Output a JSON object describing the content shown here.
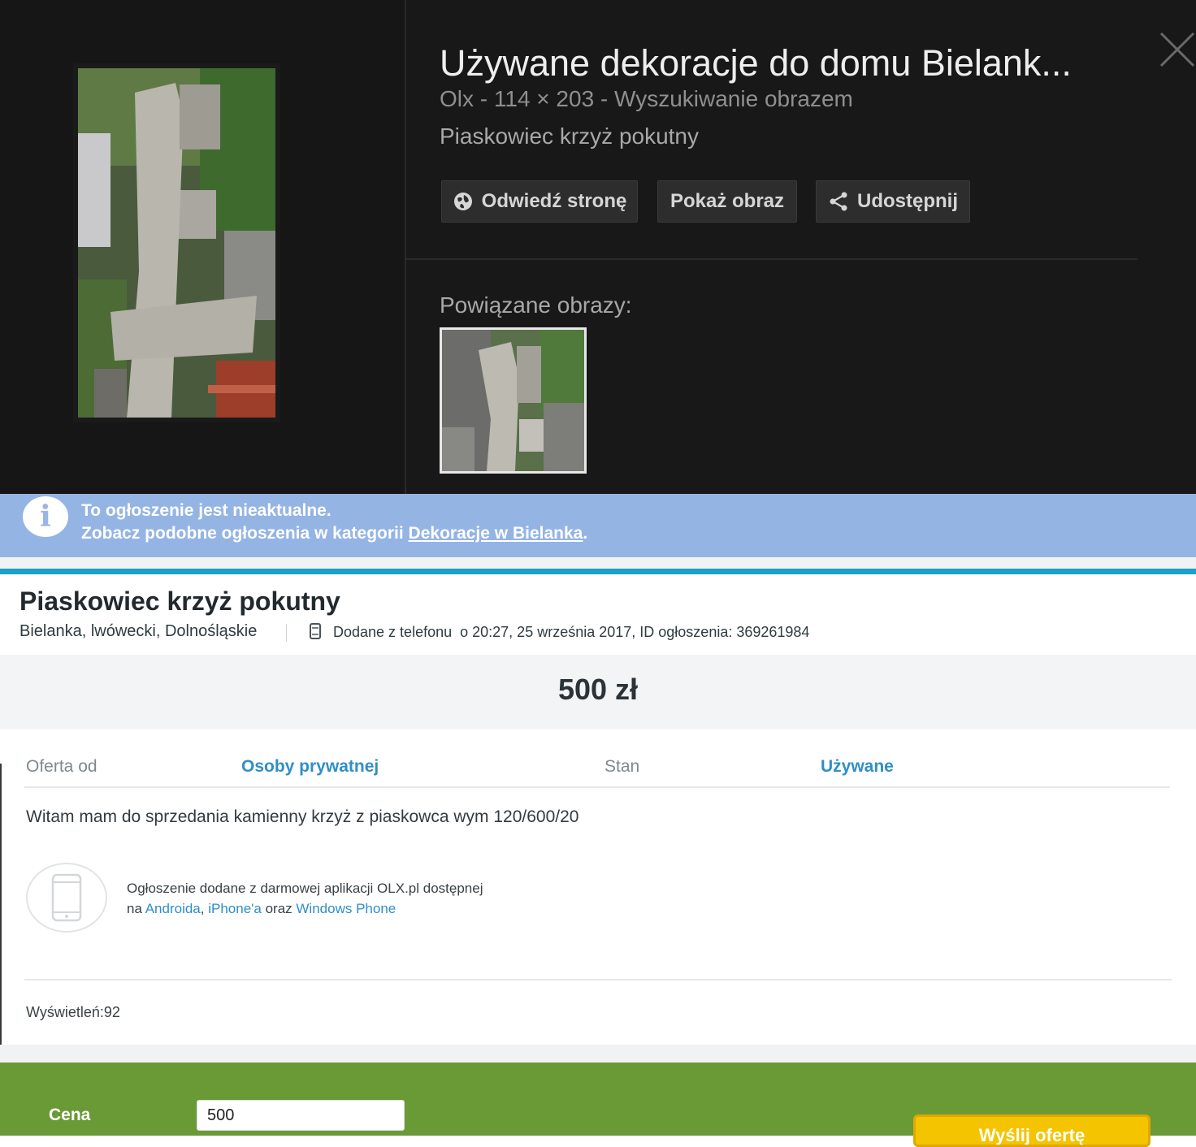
{
  "viewer": {
    "title": "Używane dekoracje do domu Bielank...",
    "meta": "Olx - 114 × 203 - Wyszukiwanie obrazem",
    "description": "Piaskowiec krzyż pokutny",
    "buttons": {
      "visit": "Odwiedź stronę",
      "show": "Pokaż obraz",
      "share": "Udostępnij"
    },
    "related_label": "Powiązane obrazy:"
  },
  "alert": {
    "line1": "To ogłoszenie jest nieaktualne.",
    "line2_prefix": "Zobacz podobne ogłoszenia w kategorii ",
    "line2_link": "Dekoracje w Bielanka",
    "line2_suffix": "."
  },
  "ad": {
    "title": "Piaskowiec krzyż pokutny",
    "location": "Bielanka, lwówecki, Dolnośląskie",
    "added_from": "Dodane z telefonu",
    "added_meta": "o 20:27, 25 września 2017, ID ogłoszenia: 369261984",
    "price": "500 zł",
    "details": [
      {
        "label": "Oferta od",
        "value": "Osoby prywatnej"
      },
      {
        "label": "Stan",
        "value": "Używane"
      }
    ],
    "description": "Witam mam do sprzedania kamienny krzyż z piaskowca wym 120/600/20",
    "app_note": {
      "line1": "Ogłoszenie dodane z darmowej aplikacji OLX.pl dostępnej",
      "na": "na ",
      "android": "Androida",
      "sep": ", ",
      "iphone": "iPhone'a",
      "oraz": " oraz ",
      "windows": "Windows Phone"
    },
    "views": "Wyświetleń:92"
  },
  "offer_form": {
    "price_label": "Cena",
    "price_value": "500",
    "button_label": "Wyślij ofertę"
  },
  "colors": {
    "viewer_bg": "#181818",
    "alert_bg": "#94b4e4",
    "accent_teal": "#1aa0c9",
    "link_blue": "#2f8fc7",
    "green_panel": "#6a9a36",
    "yellow_button": "#f4c400"
  },
  "icons": [
    "globe-icon",
    "share-icon",
    "close-icon",
    "info-icon",
    "phone-icon"
  ]
}
